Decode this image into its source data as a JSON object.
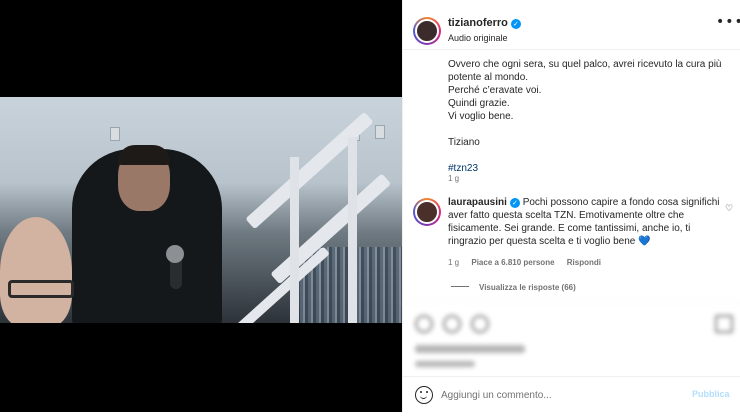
{
  "post": {
    "username": "tizianoferro",
    "audio_label": "Audio originale",
    "more_label": "•••",
    "caption": {
      "line1": "Ovvero che ogni sera, su quel palco, avrei ricevuto la cura più potente al mondo.",
      "line2": "Perché c’eravate voi.",
      "line3": "Quindi grazie.",
      "line4": "Vi voglio bene.",
      "signature": "Tiziano",
      "hashtag": "#tzn23"
    },
    "time": "1 g"
  },
  "comment": {
    "username": "laurapausini",
    "text": "Pochi possono capire a fondo cosa significhi aver fatto questa scelta TZN. Emotivamente oltre che fisicamente. Sei grande. E come tantissimi, anche io, ti ringrazio per questa scelta e ti voglio bene",
    "emoji": "💙",
    "time": "1 g",
    "likes": "Piace a 6.810 persone",
    "reply_label": "Rispondi",
    "view_replies": "Visualizza le risposte (66)"
  },
  "composer": {
    "placeholder": "Aggiungi un commento...",
    "publish_label": "Pubblica"
  },
  "icons": {
    "verified": "verified-check-icon",
    "mute": "speaker-muted-icon",
    "like": "heart-outline-icon",
    "emoji": "smiley-icon"
  },
  "colors": {
    "verified": "#0095f6",
    "hashtag": "#00376b",
    "publish_disabled": "#b2dffc"
  }
}
